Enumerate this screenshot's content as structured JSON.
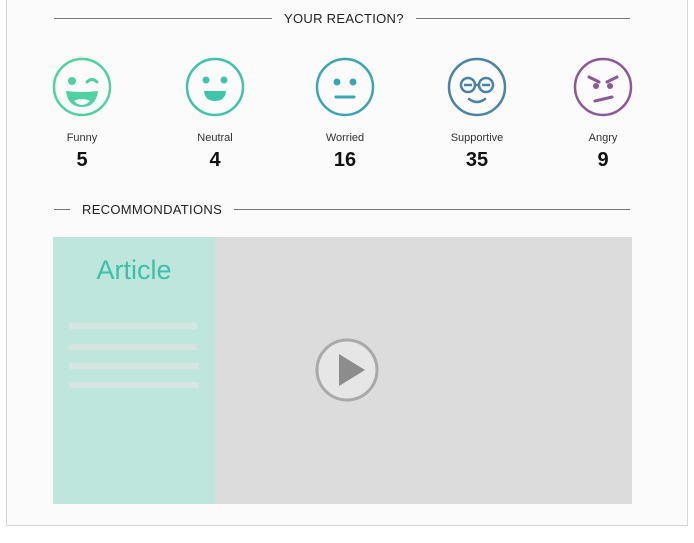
{
  "reaction_section": {
    "title": "YOUR REACTION?",
    "reactions": [
      {
        "label": "Funny",
        "count": "5",
        "icon": "winking-laughing-face-icon",
        "color": "#4fd2a1"
      },
      {
        "label": "Neutral",
        "count": "4",
        "icon": "smiling-face-icon",
        "color": "#3ec4a8"
      },
      {
        "label": "Worried",
        "count": "16",
        "icon": "neutral-face-icon",
        "color": "#3aa6b4"
      },
      {
        "label": "Supportive",
        "count": "35",
        "icon": "glasses-smiling-face-icon",
        "color": "#4b82a6"
      },
      {
        "label": "Angry",
        "count": "9",
        "icon": "angry-face-icon",
        "color": "#8a5a96"
      }
    ]
  },
  "recommendations_section": {
    "title": "RECOMMONDATIONS",
    "article": {
      "title": "Article",
      "panel_color": "#bfe6dd",
      "title_color": "#3dbfa8"
    },
    "video": {
      "icon": "play-icon",
      "background": "#dcdcdc"
    }
  }
}
